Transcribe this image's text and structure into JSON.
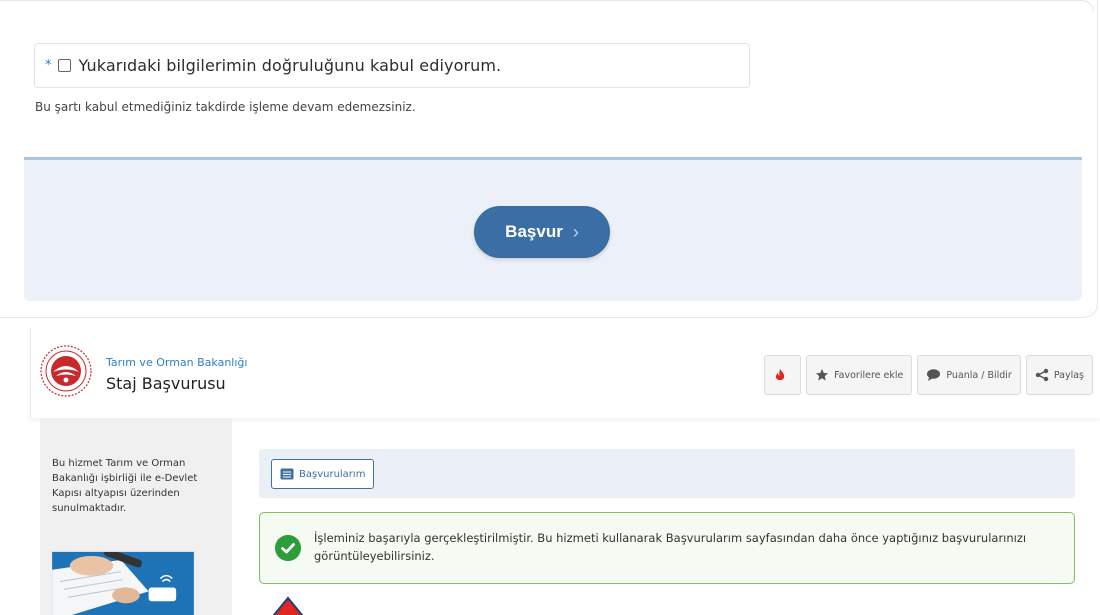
{
  "consent": {
    "required_marker": "*",
    "label": "Yukarıdaki bilgilerimin doğruluğunu kabul ediyorum.",
    "checked": false,
    "hint": "Bu şartı kabul etmediğiniz takdirde işleme devam edemezsiniz."
  },
  "apply_button": {
    "label": "Başvur",
    "chevron": "›"
  },
  "header": {
    "ministry": "Tarım ve Orman Bakanlığı",
    "service_title": "Staj Başvurusu",
    "buttons": [
      {
        "label": "",
        "icon": "flame-icon"
      },
      {
        "label": "Favorilere ekle",
        "icon": "star-icon"
      },
      {
        "label": "Puanla / Bildir",
        "icon": "comment-icon"
      },
      {
        "label": "Paylaş",
        "icon": "share-icon"
      }
    ]
  },
  "sidebar": {
    "info": "Bu hizmet Tarım ve Orman Bakanlığı işbirliği ile e-Devlet Kapısı altyapısı üzerinden sunulmaktadır."
  },
  "tabs": {
    "my_applications": "Başvurularım"
  },
  "alert": {
    "type": "success",
    "message": "İşleminiz başarıyla gerçekleştirilmiştir. Bu hizmeti kullanarak Başvurularım sayfasından daha önce yaptığınız başvurularınızı görüntüleyebilirsiniz."
  },
  "colors": {
    "primary": "#3a6ea5",
    "success": "#2e9c3b",
    "accent_blue": "#2c7fc6",
    "danger": "#e0281e"
  }
}
